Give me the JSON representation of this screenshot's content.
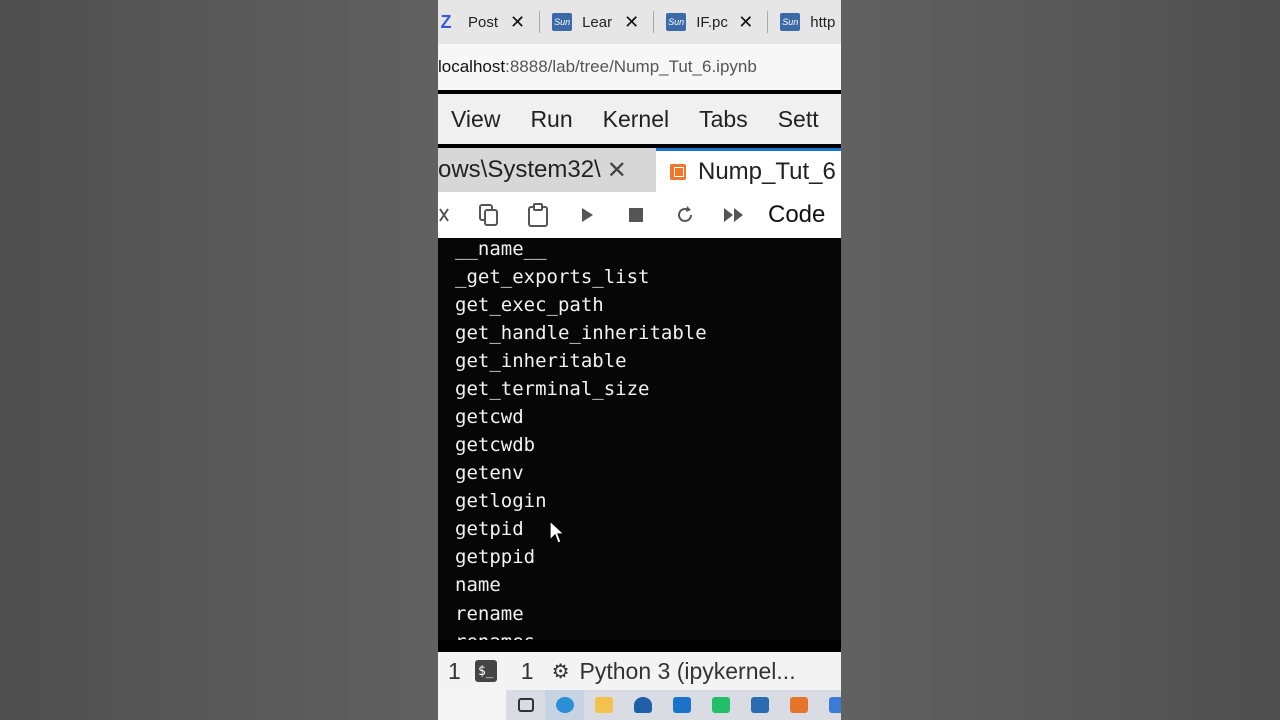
{
  "browser": {
    "tabs": [
      {
        "icon": "z-logo-icon",
        "favicon_text": "Z",
        "title": "Post"
      },
      {
        "icon": "sun-favicon-icon",
        "favicon_text": "Sun",
        "title": "Lear"
      },
      {
        "icon": "sun-favicon-icon",
        "favicon_text": "Sun",
        "title": "IF.pc"
      },
      {
        "icon": "sun-favicon-icon",
        "favicon_text": "Sun",
        "title": "http"
      }
    ],
    "address": {
      "host": "localhost",
      "path": ":8888/lab/tree/Nump_Tut_6.ipynb"
    }
  },
  "menu": {
    "items": [
      "View",
      "Run",
      "Kernel",
      "Tabs",
      "Sett"
    ]
  },
  "doc_tabs": {
    "inactive": {
      "title": "ows\\System32\\"
    },
    "active": {
      "title": "Nump_Tut_6"
    }
  },
  "toolbar": {
    "cell_type": "Code"
  },
  "output": {
    "lines": [
      "__name__",
      "_get_exports_list",
      "get_exec_path",
      "get_handle_inheritable",
      "get_inheritable",
      "get_terminal_size",
      "getcwd",
      "getcwdb",
      "getenv",
      "getlogin",
      "getpid",
      "getppid",
      "name",
      "rename",
      "renames"
    ]
  },
  "status": {
    "count_1": "1",
    "terminal_badge": "$_",
    "count_2": "1",
    "kernel": "Python 3 (ipykernel..."
  },
  "colors": {
    "accent": "#1976d2",
    "notebook_icon": "#f37726"
  }
}
